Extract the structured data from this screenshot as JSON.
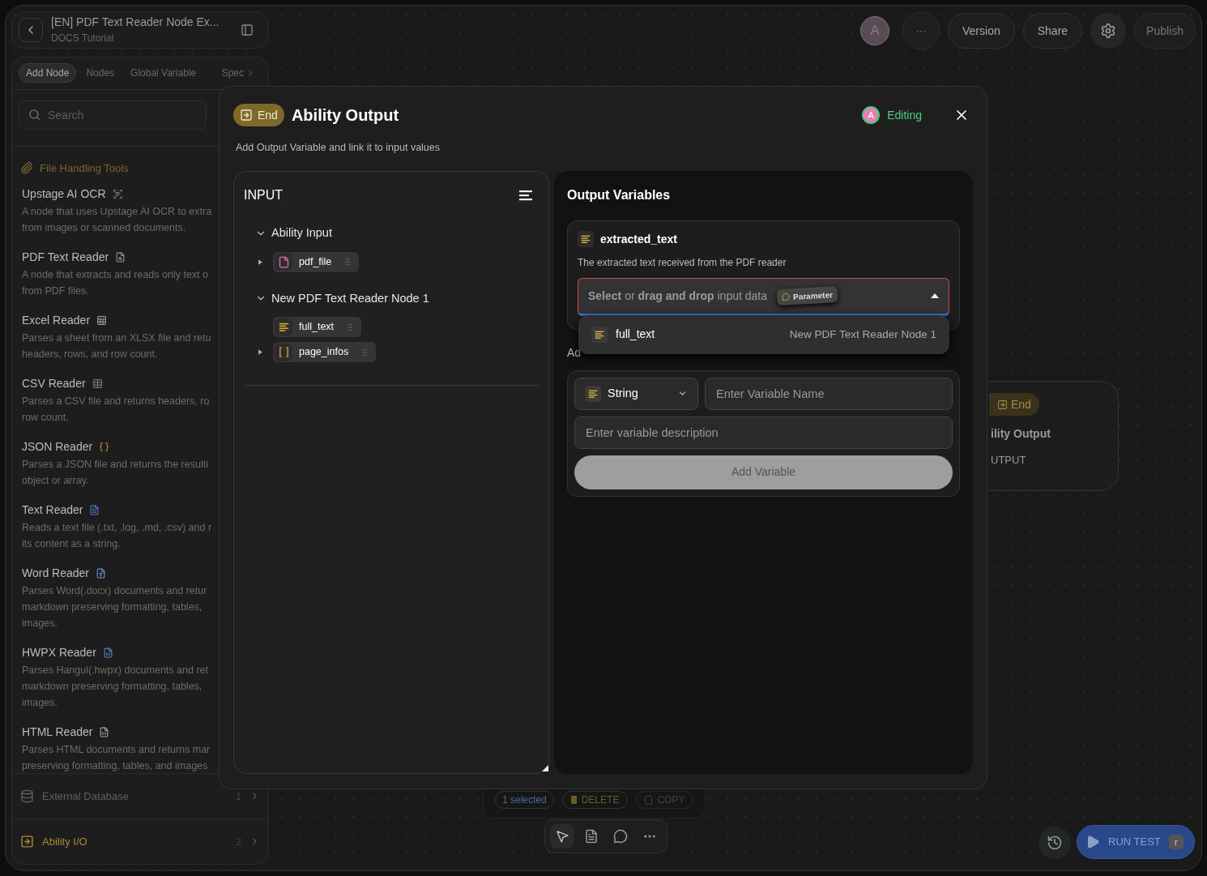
{
  "project": {
    "title": "[EN] PDF Text Reader Node Ex...",
    "subtitle": "DOCS Tutorial"
  },
  "sidebar": {
    "tabs": [
      {
        "label": "Add Node",
        "selected": true
      },
      {
        "label": "Nodes",
        "selected": false
      },
      {
        "label": "Global Variable",
        "selected": false
      },
      {
        "label": "Spec",
        "selected": false
      }
    ],
    "search": {
      "placeholder": "Search"
    },
    "section": "File Handling Tools",
    "items": [
      {
        "name": "Upstage AI OCR",
        "lines": [
          "A node that uses Upstage AI OCR to extra",
          "from images or scanned documents."
        ]
      },
      {
        "name": "PDF Text Reader",
        "lines": [
          "A node that extracts and reads only text o",
          "from PDF files."
        ]
      },
      {
        "name": "Excel Reader",
        "lines": [
          "Parses a sheet from an XLSX file and retu",
          "headers, rows, and row count."
        ]
      },
      {
        "name": "CSV Reader",
        "lines": [
          "Parses a CSV file and returns headers, ro",
          "row count."
        ]
      },
      {
        "name": "JSON Reader",
        "lines": [
          "Parses a JSON file and returns the resulti",
          "object or array."
        ]
      },
      {
        "name": "Text Reader",
        "lines": [
          "Reads a text file (.txt, .log, .md, .csv) and r",
          "its content as a string."
        ]
      },
      {
        "name": "Word Reader",
        "lines": [
          "Parses Word(.docx) documents and retur",
          "markdown preserving formatting, tables,",
          "images."
        ]
      },
      {
        "name": "HWPX Reader",
        "lines": [
          "Parses Hangul(.hwpx) documents and ret",
          "markdown preserving formatting, tables,",
          "images."
        ]
      },
      {
        "name": "HTML Reader",
        "lines": [
          "Parses HTML documents and returns mar",
          "preserving formatting, tables, and images"
        ]
      }
    ],
    "groups": [
      {
        "label": "External Database",
        "count": "1",
        "disabled": true
      },
      {
        "label": "Ability I/O",
        "count": "2",
        "disabled": false
      }
    ]
  },
  "topbar": {
    "avatar": "A",
    "more": "···",
    "buttons": [
      "Version",
      "Share"
    ],
    "publish": "Publish"
  },
  "modal": {
    "badge": "End",
    "title": "Ability Output",
    "editor_avatar": "A",
    "status": "Editing",
    "subtitle": "Add Output Variable and link it to input values",
    "input": {
      "title": "INPUT",
      "groups": [
        {
          "label": "Ability Input",
          "expanded": true,
          "children": [
            {
              "name": "pdf_file",
              "kind": "file",
              "expandable": true
            }
          ]
        },
        {
          "label": "New PDF Text Reader Node 1",
          "expanded": true,
          "children": [
            {
              "name": "full_text",
              "kind": "string",
              "expandable": false
            },
            {
              "name": "page_infos",
              "kind": "array",
              "expandable": true
            }
          ]
        }
      ]
    },
    "output": {
      "title": "Output Variables",
      "variable": {
        "name": "extracted_text",
        "description": "The extracted text received from the PDF reader",
        "placeholder": "**Select** or **drag and drop** input data",
        "tag": "Parameter",
        "open": true
      },
      "options": [
        {
          "name": "full_text",
          "source": "New PDF Text Reader Node 1"
        }
      ],
      "add_label": "Ad",
      "form": {
        "type": "String",
        "name_placeholder": "Enter Variable Name",
        "description_placeholder": "Enter variable description",
        "button": "Add Variable"
      }
    }
  },
  "canvas_node": {
    "badge": "End",
    "title": "ility Output",
    "label": "UTPUT"
  },
  "selection_bar": {
    "count": "1 selected",
    "delete": "DELETE",
    "copy": "COPY"
  },
  "tools": [
    {
      "kind": "pointer",
      "selected": true
    },
    {
      "kind": "note",
      "selected": false
    },
    {
      "kind": "comment",
      "selected": false
    },
    {
      "kind": "more",
      "selected": false
    }
  ],
  "run": {
    "label": "RUN TEST",
    "key": "r"
  }
}
